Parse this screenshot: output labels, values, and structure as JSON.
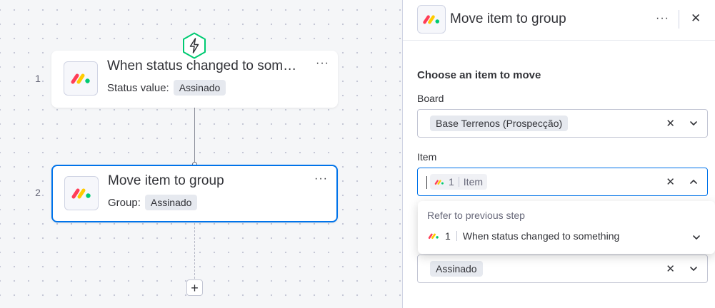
{
  "canvas": {
    "steps": [
      {
        "number": "1",
        "title": "When status changed to som…",
        "label": "Status value:",
        "value": "Assinado"
      },
      {
        "number": "2",
        "title": "Move item to group",
        "label": "Group:",
        "value": "Assinado"
      }
    ],
    "add_step_label": "+",
    "more_label": "···"
  },
  "panel": {
    "title": "Move item to group",
    "more_label": "···",
    "close_label": "✕",
    "section_title": "Choose an item to move",
    "board": {
      "label": "Board",
      "value": "Base Terrenos (Prospecção)"
    },
    "item": {
      "label": "Item",
      "step_ref": "1",
      "value": "Item"
    },
    "dropdown": {
      "caption": "Refer to previous step",
      "option_number": "1",
      "option_label": "When status changed to something"
    },
    "group_value": "Assinado",
    "clear_label": "✕"
  },
  "colors": {
    "accent": "#0073ea",
    "trigger_border": "#00ca72",
    "logo_red": "#ff3d57",
    "logo_yellow": "#ffcb00",
    "logo_green": "#00ca72"
  },
  "icons": [
    "monday-logo-icon",
    "lightning-icon",
    "more-icon",
    "close-icon",
    "chevron-down-icon",
    "chevron-up-icon",
    "plus-icon"
  ]
}
